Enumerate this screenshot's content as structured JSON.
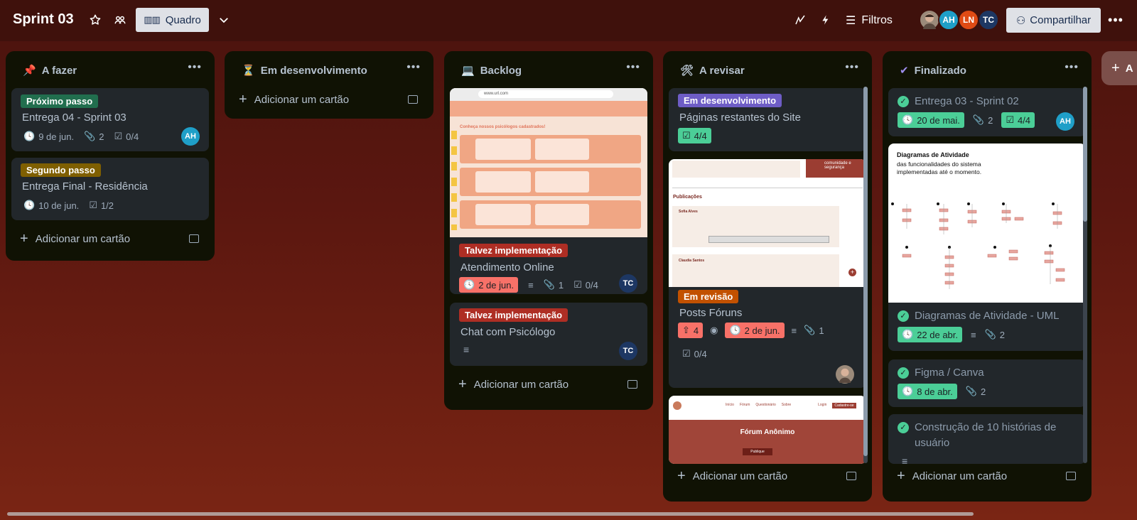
{
  "header": {
    "board_title": "Sprint 03",
    "view_label": "Quadro",
    "filter_label": "Filtros",
    "share_label": "Compartilhar",
    "members": [
      {
        "initials": "AH",
        "color": "#1f9fc8"
      },
      {
        "initials": "LN",
        "color": "#e04b14"
      },
      {
        "initials": "TC",
        "color": "#1d3763"
      }
    ]
  },
  "lists": {
    "afazer": {
      "title": "A fazer",
      "icon": "📌",
      "add_label": "Adicionar um cartão",
      "cards": [
        {
          "label": "Próximo passo",
          "label_color": "#4bce97",
          "title": "Entrega 04 - Sprint 03",
          "due": "9 de jun.",
          "attachments": "2",
          "checklist": "0/4",
          "member": "AH"
        },
        {
          "label": "Segundo passo",
          "label_color": "#f5cd47",
          "title": "Entrega Final - Residência",
          "due": "10 de jun.",
          "checklist": "1/2"
        }
      ]
    },
    "emdev": {
      "title": "Em desenvolvimento",
      "icon": "⏳",
      "add_label": "Adicionar um cartão"
    },
    "backlog": {
      "title": "Backlog",
      "icon": "💻",
      "add_label": "Adicionar um cartão",
      "cards": [
        {
          "label": "Talvez implementação",
          "label_color": "#f87168",
          "title": "Atendimento Online",
          "due": "2 de jun.",
          "attachments": "1",
          "checklist": "0/4",
          "member": "TC",
          "cover_url": "www.url.com",
          "cover_heading": "Conheça nossos psicólogos cadastrados!"
        },
        {
          "label": "Talvez implementação",
          "label_color": "#f87168",
          "title": "Chat com Psicólogo",
          "member": "TC"
        }
      ]
    },
    "arevisar": {
      "title": "A revisar",
      "icon": "🛠",
      "add_label": "Adicionar um cartão",
      "cards": [
        {
          "label": "Em desenvolvimento",
          "label_color": "#9f8fef",
          "title": "Páginas restantes do Site",
          "checklist": "4/4"
        },
        {
          "label": "Em revisão",
          "label_color": "#fea362",
          "title": "Posts Fóruns",
          "votes": "4",
          "due": "2 de jun.",
          "attachments": "1",
          "checklist": "0/4",
          "cover_section": "Publicações",
          "cover_badge": "comunidade e segurança",
          "cover_post1_author": "Sofia Alves",
          "cover_post2_author": "Claudia Santos"
        },
        {
          "cover_heading": "Fórum Anônimo",
          "cover_button": "Publique",
          "cover_nav": [
            "Início",
            "Fórum",
            "Questionário",
            "Sobre",
            "Login",
            "Cadastre-se"
          ]
        }
      ]
    },
    "finalizado": {
      "title": "Finalizado",
      "icon": "✔",
      "add_label": "Adicionar um cartão",
      "cards": [
        {
          "title": "Entrega 03 - Sprint 02",
          "due": "20 de mai.",
          "attachments": "2",
          "checklist": "4/4",
          "member": "AH"
        },
        {
          "title": "Diagramas de Atividade - UML",
          "due": "22 de abr.",
          "attachments": "2",
          "cover_title": "Diagramas de Atividade",
          "cover_subtitle": "das funcionalidades do sistema implementadas até o momento."
        },
        {
          "title": "Figma / Canva",
          "due": "8 de abr.",
          "attachments": "2"
        },
        {
          "title": "Construção de 10 histórias de usuário"
        }
      ]
    },
    "new_list_label": "A"
  }
}
